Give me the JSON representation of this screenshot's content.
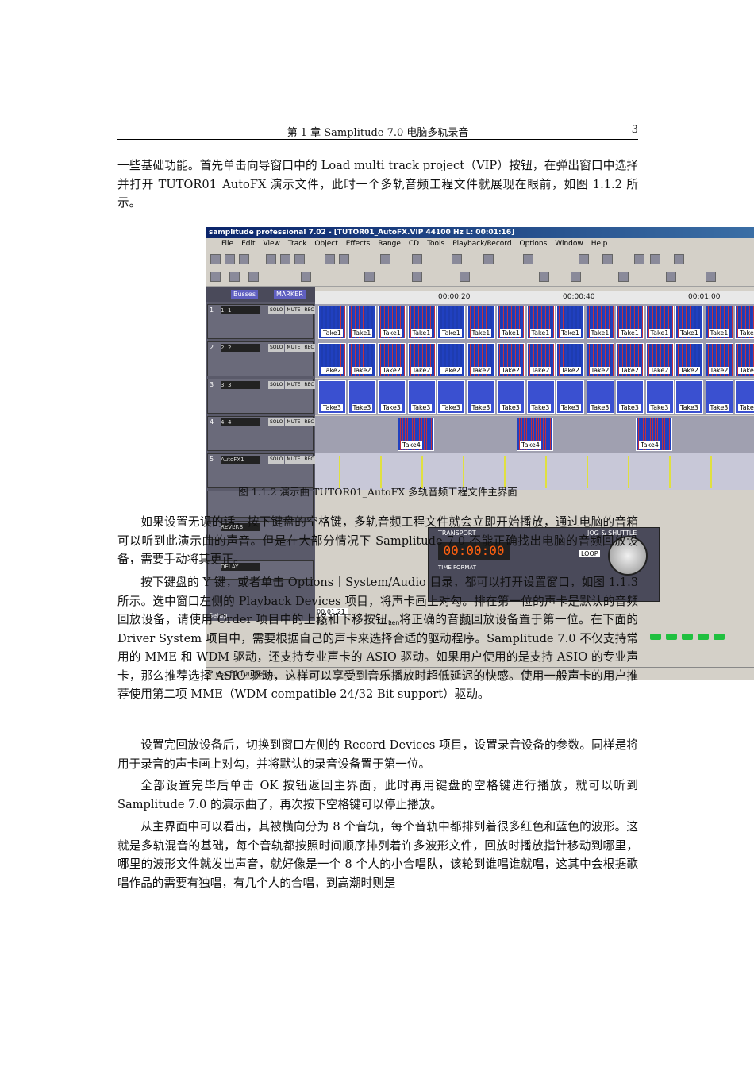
{
  "header": {
    "title": "第 1 章   Samplitude 7.0 电脑多轨录音",
    "page_number": "3"
  },
  "paragraphs": [
    "一些基础功能。首先单击向导窗口中的 Load multi track project（VIP）按钮，在弹出窗口中选择并打开 TUTOR01_AutoFX 演示文件，此时一个多轨音频工程文件就展现在眼前，如图 1.1.2 所示。",
    "如果设置无误的话，按下键盘的空格键，多轨音频工程文件就会立即开始播放，通过电脑的音箱可以听到此演示曲的声音。但是在大部分情况下 Samplitude 7.0 不能正确找出电脑的音频回放设备，需要手动将其更正。",
    "按下键盘的 Y 键，或者单击 Options｜System/Audio 目录，都可以打开设置窗口，如图 1.1.3 所示。选中窗口左侧的 Playback Devices 项目，将声卡画上对勾。排在第一位的声卡是默认的音频回放设备，请使用 Order 项目中的上移和下移按钮，将正确的音频回放设备置于第一位。在下面的 Driver System 项目中，需要根据自己的声卡来选择合适的驱动程序。Samplitude 7.0 不仅支持常用的 MME 和 WDM 驱动，还支持专业声卡的 ASIO 驱动。如果用户使用的是支持 ASIO 的专业声卡，那么推荐选择 ASIO 驱动，这样可以享受到音乐播放时超低延迟的快感。使用一般声卡的用户推荐使用第二项 MME（WDM compatible 24/32 Bit support）驱动。",
    "设置完回放设备后，切换到窗口左侧的 Record Devices 项目，设置录音设备的参数。同样是将用于录音的声卡画上对勾，并将默认的录音设备置于第一位。",
    "全部设置完毕后单击 OK 按钮返回主界面，此时再用键盘的空格键进行播放，就可以听到 Samplitude 7.0 的演示曲了，再次按下空格键可以停止播放。",
    "从主界面中可以看出，其被横向分为 8 个音轨，每个音轨中都排列着很多红色和蓝色的波形。这就是多轨混音的基础，每个音轨都按照时间顺序排列着许多波形文件，回放时播放指针移动到哪里，哪里的波形文件就发出声音，就好像是一个 8 个人的小合唱队，该轮到谁唱谁就唱，这其中会根据歌唱作品的需要有独唱，有几个人的合唱，到高潮时则是"
  ],
  "figure": {
    "caption": "图 1.1.2   演示曲 TUTOR01_AutoFX 多轨音频工程文件主界面",
    "screenshot": {
      "window_title": "samplitude professional 7.02 - [TUTOR01_AutoFX.VIP   44100 Hz L: 00:01:16]",
      "menu": [
        "File",
        "Edit",
        "View",
        "Track",
        "Object",
        "Effects",
        "Range",
        "CD",
        "Tools",
        "Playback/Record",
        "Options",
        "Window",
        "Help"
      ],
      "buses_label": "Busses",
      "marker_label": "MARKER",
      "ruler": [
        "00:00:20",
        "00:00:40",
        "00:01:00"
      ],
      "tracks": [
        {
          "num": "1",
          "name": "1: 1",
          "clip": "Take1"
        },
        {
          "num": "2",
          "name": "2: 2",
          "clip": "Take2"
        },
        {
          "num": "3",
          "name": "3: 3",
          "clip": "Take3"
        },
        {
          "num": "4",
          "name": "4: 4",
          "clip": "Take4"
        },
        {
          "num": "5",
          "name": "AutoFX1",
          "clip": ""
        }
      ],
      "track_buttons": [
        "SOLO",
        "MUTE",
        "REC"
      ],
      "transport_title": "TRANSPORT",
      "transport_time": "00:00:00",
      "time_format": "TIME FORMAT",
      "loop_label": "LOOP",
      "jog_label": "JOG & SHUTTLE",
      "reverb": "REVERB",
      "delay": "DELAY",
      "setup": "Setup",
      "pos_time": "00:01:21",
      "pos_label": "Pos",
      "len_label": "Len",
      "end_label": "End",
      "status": "Press F1 for Help..."
    }
  }
}
